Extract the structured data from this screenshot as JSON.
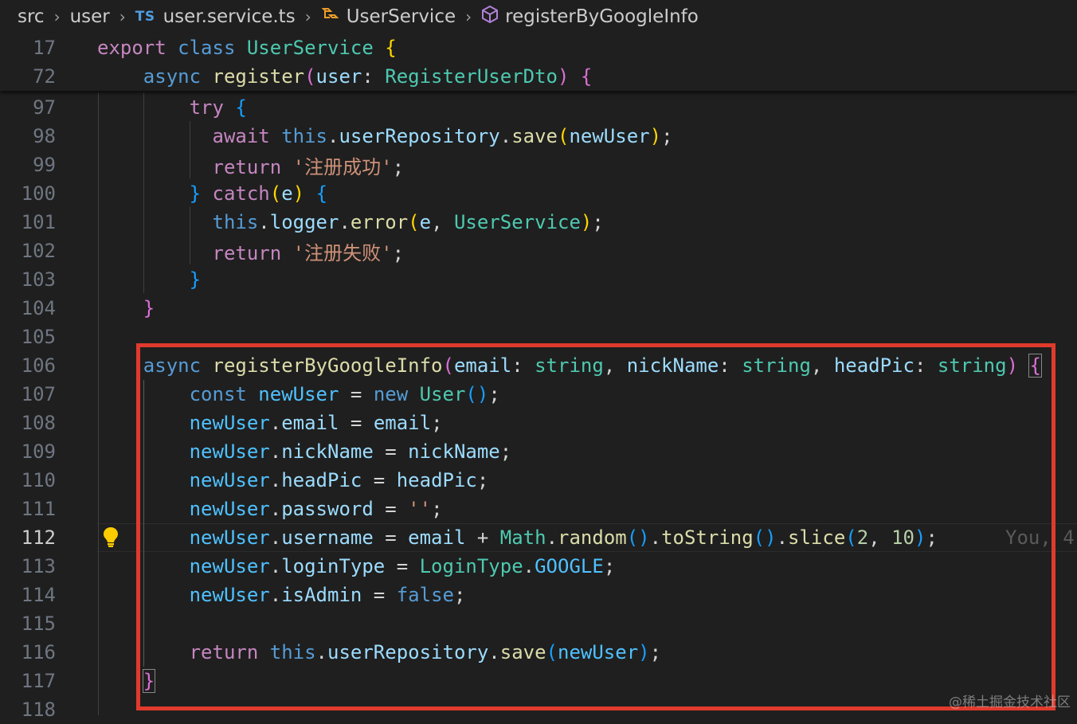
{
  "breadcrumb": {
    "items": [
      "src",
      "user",
      "user.service.ts",
      "UserService",
      "registerByGoogleInfo"
    ],
    "ts_badge": "TS"
  },
  "sticky": {
    "line_numbers": [
      "17",
      "72"
    ]
  },
  "lines": [
    {
      "n": "97"
    },
    {
      "n": "98"
    },
    {
      "n": "99"
    },
    {
      "n": "100"
    },
    {
      "n": "101"
    },
    {
      "n": "102"
    },
    {
      "n": "103"
    },
    {
      "n": "104"
    },
    {
      "n": "105"
    },
    {
      "n": "106"
    },
    {
      "n": "107"
    },
    {
      "n": "108"
    },
    {
      "n": "109"
    },
    {
      "n": "110"
    },
    {
      "n": "111"
    },
    {
      "n": "112"
    },
    {
      "n": "113"
    },
    {
      "n": "114"
    },
    {
      "n": "115"
    },
    {
      "n": "116"
    },
    {
      "n": "117"
    },
    {
      "n": "118"
    }
  ],
  "code": {
    "export": "export",
    "class": "class",
    "UserService": "UserService",
    "async": "async",
    "register": "register",
    "user": "user",
    "RegisterUserDto": "RegisterUserDto",
    "try": "try",
    "await": "await",
    "this": "this",
    "userRepository": "userRepository",
    "save": "save",
    "newUser": "newUser",
    "return": "return",
    "str_success": "'注册成功'",
    "str_fail": "'注册失败'",
    "catch": "catch",
    "e": "e",
    "logger": "logger",
    "error": "error",
    "registerByGoogleInfo": "registerByGoogleInfo",
    "email": "email",
    "string": "string",
    "nickName": "nickName",
    "headPic": "headPic",
    "const": "const",
    "new": "new",
    "User": "User",
    "password": "password",
    "empty_str": "''",
    "username": "username",
    "Math": "Math",
    "random": "random",
    "toString": "toString",
    "slice": "slice",
    "n2": "2",
    "n10": "10",
    "loginType": "loginType",
    "LoginType": "LoginType",
    "GOOGLE": "GOOGLE",
    "isAdmin": "isAdmin",
    "false": "false"
  },
  "blame": "You, 4",
  "watermark": "@稀土掘金技术社区",
  "colors": {
    "highlight_box": "#e03a2d",
    "keyword": "#569cd6",
    "control": "#c586c0",
    "function": "#dcdcaa",
    "type": "#4ec9b0",
    "variable": "#9cdcfe",
    "string": "#ce9178"
  }
}
